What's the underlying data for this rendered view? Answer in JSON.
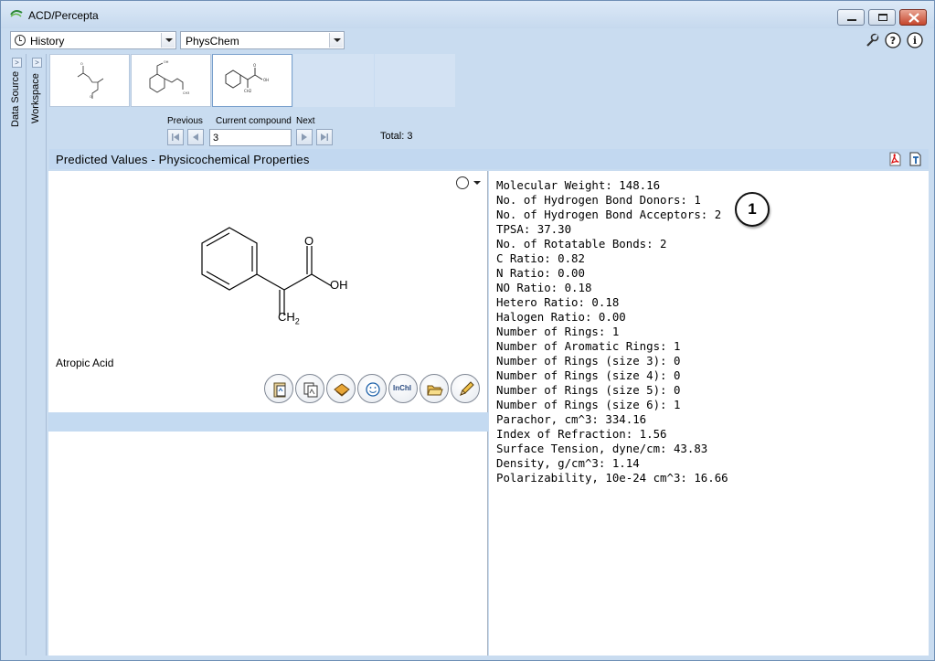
{
  "window": {
    "title": "ACD/Percepta"
  },
  "toolbar": {
    "history_combo": "History",
    "module_combo": "PhysChem",
    "icons": [
      "wrench-icon",
      "help-icon",
      "info-icon"
    ]
  },
  "side_tabs": [
    "Data Source",
    "Workspace"
  ],
  "navigation": {
    "previous_label": "Previous",
    "current_label": "Current compound",
    "next_label": "Next",
    "current_value": "3",
    "total": "Total: 3"
  },
  "section": {
    "title": "Predicted Values - Physicochemical Properties"
  },
  "compound": {
    "name": "Atropic Acid",
    "atom_labels": {
      "o": "O",
      "oh": "OH",
      "ch": "CH",
      "sub": "2"
    }
  },
  "properties": [
    "Molecular Weight: 148.16",
    "No. of Hydrogen Bond Donors: 1",
    "No. of Hydrogen Bond Acceptors: 2",
    "TPSA: 37.30",
    "No. of Rotatable Bonds: 2",
    "C Ratio: 0.82",
    "N Ratio: 0.00",
    "NO Ratio: 0.18",
    "Hetero Ratio: 0.18",
    "Halogen Ratio: 0.00",
    "Number of Rings: 1",
    "Number of Aromatic Rings: 1",
    "Number of Rings (size 3): 0",
    "Number of Rings (size 4): 0",
    "Number of Rings (size 5): 0",
    "Number of Rings (size 6): 1",
    "Parachor, cm^3: 334.16",
    "Index of Refraction: 1.56",
    "Surface Tension, dyne/cm: 43.83",
    "Density, g/cm^3: 1.14",
    "Polarizability, 10e-24 cm^3: 16.66"
  ],
  "callout": "1",
  "tool_buttons": [
    "copy-structure-icon",
    "copy-image-icon",
    "book-icon",
    "smiley-icon",
    "InChI",
    "open-folder-icon",
    "pencil-icon"
  ]
}
